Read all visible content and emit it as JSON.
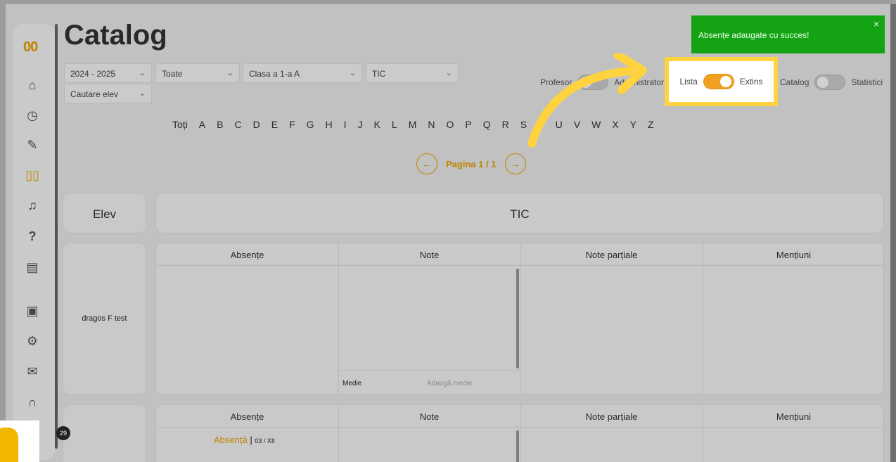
{
  "page": {
    "title": "Catalog"
  },
  "filters": {
    "year": "2024 - 2025",
    "scope": "Toate",
    "class": "Clasa a 1-a A",
    "subject": "TIC",
    "student_search": "Cautare elev"
  },
  "toggles": {
    "profesor_label": "Profesor",
    "administrator_label": "Administrator",
    "lista_label": "Lista",
    "extins_label": "Extins",
    "catalog_label": "Catalog",
    "statistici_label": "Statistici"
  },
  "alphabet": [
    "Toți",
    "A",
    "B",
    "C",
    "D",
    "E",
    "F",
    "G",
    "H",
    "I",
    "J",
    "K",
    "L",
    "M",
    "N",
    "O",
    "P",
    "Q",
    "R",
    "S",
    "T",
    "U",
    "V",
    "W",
    "X",
    "Y",
    "Z"
  ],
  "pagination": {
    "label": "Pagina 1 / 1"
  },
  "table": {
    "student_header": "Elev",
    "subject_header": "TIC",
    "columns": [
      "Absențe",
      "Note",
      "Note parțiale",
      "Mențiuni"
    ],
    "rows": [
      {
        "student": "dragos F test",
        "average_label": "Medie",
        "average_placeholder": "Adaugă medie"
      },
      {
        "student": "",
        "absence_label": "Absență",
        "absence_date": "03 / XII"
      }
    ]
  },
  "toast": {
    "message": "Absențe adaugate cu succes!",
    "close": "×"
  },
  "sidebar": {
    "logo": "00",
    "icons": [
      "home-icon",
      "clock-icon",
      "pencil-icon",
      "book-icon",
      "bell-icon",
      "help-icon",
      "document-icon",
      "contact-card-icon",
      "settings-icon",
      "mail-icon",
      "headset-icon"
    ],
    "help_glyph": "?"
  },
  "notifications_count": "29",
  "colors": {
    "accent": "#e8a200",
    "toast": "#14a314",
    "highlight": "#ffd23f"
  }
}
